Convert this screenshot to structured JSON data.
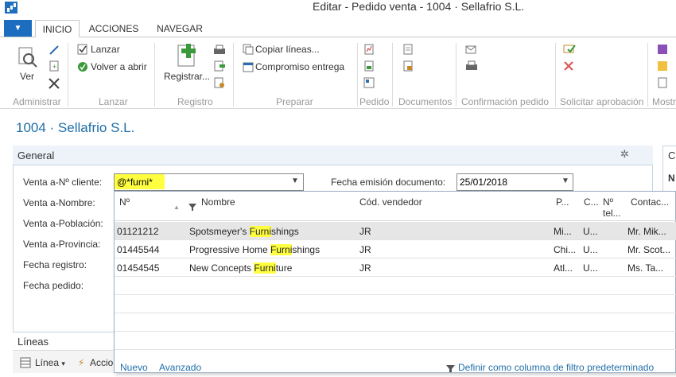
{
  "window": {
    "title": "Editar - Pedido venta - 1004 · Sellafrio S.L."
  },
  "ribbon": {
    "tabs": [
      "INICIO",
      "ACCIONES",
      "NAVEGAR"
    ],
    "groups": {
      "administrar": {
        "label": "Administrar",
        "ver": "Ver"
      },
      "lanzar": {
        "label": "Lanzar",
        "lanzar": "Lanzar",
        "volver": "Volver a abrir"
      },
      "registro": {
        "label": "Registro",
        "registrar": "Registrar..."
      },
      "preparar": {
        "label": "Preparar",
        "copiar": "Copiar líneas...",
        "compromiso": "Compromiso entrega"
      },
      "pedido": {
        "label": "Pedido"
      },
      "documentos": {
        "label": "Documentos"
      },
      "confirmacion": {
        "label": "Confirmación pedido"
      },
      "aprobacion": {
        "label": "Solicitar aprobación"
      },
      "mostrar": {
        "label": "Mostr"
      }
    }
  },
  "page": {
    "title": "1004 · Sellafrio S.L."
  },
  "general": {
    "title": "General",
    "fields": {
      "cliente_label": "Venta a-Nº cliente:",
      "cliente_value": "@*furni*",
      "nombre_label": "Venta a-Nombre:",
      "poblacion_label": "Venta a-Población:",
      "provincia_label": "Venta a-Provincia:",
      "fecha_registro_label": "Fecha registro:",
      "fecha_pedido_label": "Fecha pedido:",
      "fecha_emision_label": "Fecha emisión documento:",
      "fecha_emision_value": "25/01/2018"
    }
  },
  "side": {
    "letter1": "C",
    "letter2": "N"
  },
  "lines": {
    "title": "Líneas",
    "linea": "Línea",
    "acciones": "Accio"
  },
  "lookup": {
    "columns": {
      "no": "Nº",
      "nombre": "Nombre",
      "vendedor": "Cód. vendedor",
      "p": "P...",
      "c": "C...",
      "tel1": "Nº",
      "tel2": "tel...",
      "contacto": "Contac..."
    },
    "rows": [
      {
        "no": "01121212",
        "name_pre": "Spotsmeyer's ",
        "name_hl": "Furni",
        "name_post": "shings",
        "vendedor": "JR",
        "p": "Mi...",
        "c": "U...",
        "contacto": "Mr. Mik..."
      },
      {
        "no": "01445544",
        "name_pre": "Progressive Home ",
        "name_hl": "Furni",
        "name_post": "shings",
        "vendedor": "JR",
        "p": "Chi...",
        "c": "U...",
        "contacto": "Mr. Scot..."
      },
      {
        "no": "01454545",
        "name_pre": "New Concepts ",
        "name_hl": "Furni",
        "name_post": "ture",
        "vendedor": "JR",
        "p": "Atl...",
        "c": "U...",
        "contacto": "Ms. Ta..."
      }
    ],
    "footer": {
      "nuevo": "Nuevo",
      "avanzado": "Avanzado",
      "filtro": "Definir como columna de filtro predeterminado"
    }
  }
}
